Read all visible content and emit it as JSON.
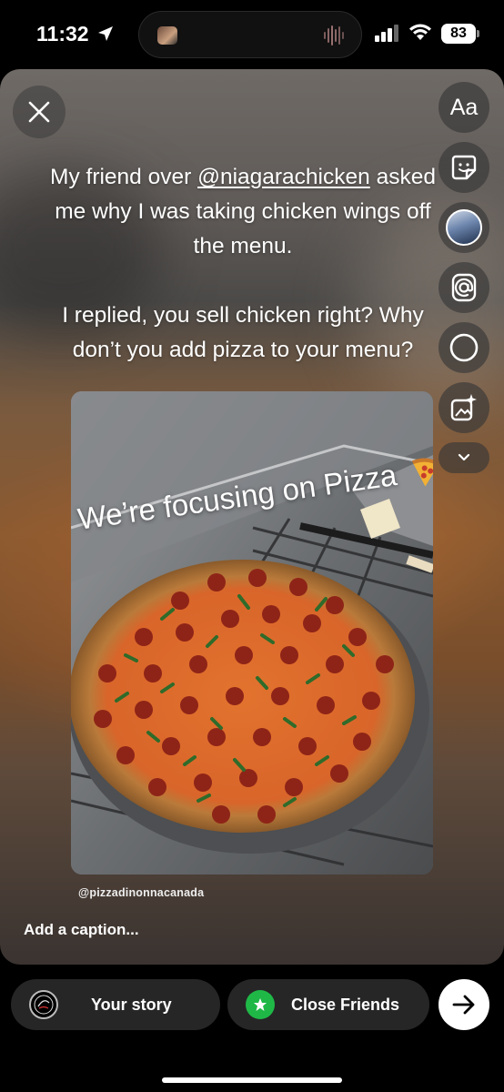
{
  "status_bar": {
    "time": "11:32",
    "battery": "83",
    "icons": [
      "location-arrow-icon",
      "audio-wave-icon",
      "cellular-signal-icon",
      "wifi-icon"
    ]
  },
  "editor": {
    "close_icon": "close-icon",
    "tools": [
      {
        "name": "text-tool",
        "label": "Aa"
      },
      {
        "name": "sticker-tool",
        "icon": "sticker-icon"
      },
      {
        "name": "photo-tool",
        "icon": "photo-thumbnail-icon"
      },
      {
        "name": "mention-tool",
        "icon": "at-icon"
      },
      {
        "name": "draw-tool",
        "icon": "circle-icon"
      },
      {
        "name": "effects-tool",
        "icon": "sparkle-image-icon"
      },
      {
        "name": "more-tools",
        "icon": "chevron-down-icon"
      }
    ]
  },
  "story_text": {
    "line1_prefix": "My friend over ",
    "mention": "@niagarachicken",
    "line1_rest": "asked me why I was taking chicken wings off the menu.",
    "paragraph2": "I replied, you sell chicken right?  Why don’t you add pizza to your menu?"
  },
  "post": {
    "overlay_text": "We’re focusing on Pizza",
    "overlay_emoji": "pizza-icon",
    "handle": "@pizzadinonnacanada"
  },
  "caption_placeholder": "Add a caption...",
  "bottom_bar": {
    "your_story": "Your story",
    "close_friends": "Close Friends",
    "next_icon": "arrow-right-icon",
    "accent_green": "#1fb847"
  }
}
